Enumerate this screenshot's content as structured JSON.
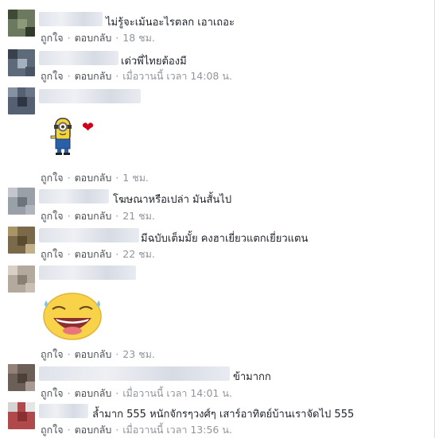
{
  "actions": {
    "like": "ถูกใจ",
    "reply": "ตอบกลับ",
    "sep": "·"
  },
  "comments": [
    {
      "text": "ไม่รู้จะเม้นอะไรตลก เอาเถอะ",
      "time": "18 ชม."
    },
    {
      "text": "เด่วพี่ไทยต้องมี",
      "time": "เมื่อวานนี้ เวลา 14:08 น."
    },
    {
      "text": "",
      "time": "1 ชม.",
      "sticker": "minion-with-heart"
    },
    {
      "text": "โฆษณาหรือเปล่า มันสั้นไป",
      "time": "21 ชม."
    },
    {
      "text": "มีฉบับเต็มมั้ย คงฮาเยี่ยวแตกเยี่ยวแตน",
      "time": "22 ชม."
    },
    {
      "text": "",
      "time": "23 ชม.",
      "sticker": "laughing-face-with-tears"
    },
    {
      "text": "ข้ามากก",
      "time": "เมื่อวานนี้ เวลา 14:01 น."
    },
    {
      "text": "ล้ำมาก 555 หนักจักรๆวงศ์ๆ เสาร์อาทิตย์บ้านเราจัดไป 555",
      "time": "เมื่อวานนี้ เวลา 13:56 น."
    }
  ],
  "colors": {
    "meta": "#90949c",
    "link": "#4b4f56",
    "heart": "#d0021b"
  }
}
